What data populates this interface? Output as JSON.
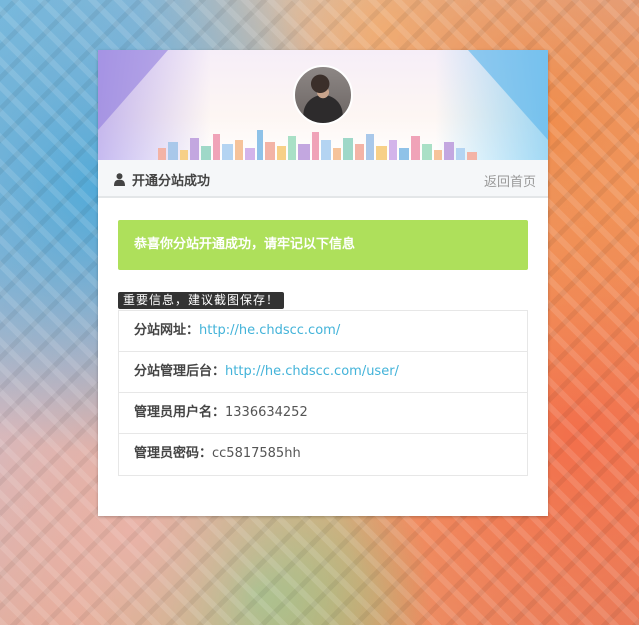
{
  "header": {
    "title": "开通分站成功",
    "back_link": "返回首页"
  },
  "success_message": "恭喜你分站开通成功，请牢记以下信息",
  "notice": "重要信息，建议截图保存！",
  "info": {
    "site_url_label": "分站网址：",
    "site_url_value": "http://he.chdscc.com/",
    "admin_url_label": "分站管理后台：",
    "admin_url_value": "http://he.chdscc.com/user/",
    "username_label": "管理员用户名：",
    "username_value": "1336634252",
    "password_label": "管理员密码：",
    "password_value": "cc5817585hh"
  },
  "colors": {
    "success_bg": "#aee05b",
    "link": "#43b3d9",
    "notice_bg": "#333333"
  },
  "icons": {
    "header_icon": "user-icon"
  }
}
